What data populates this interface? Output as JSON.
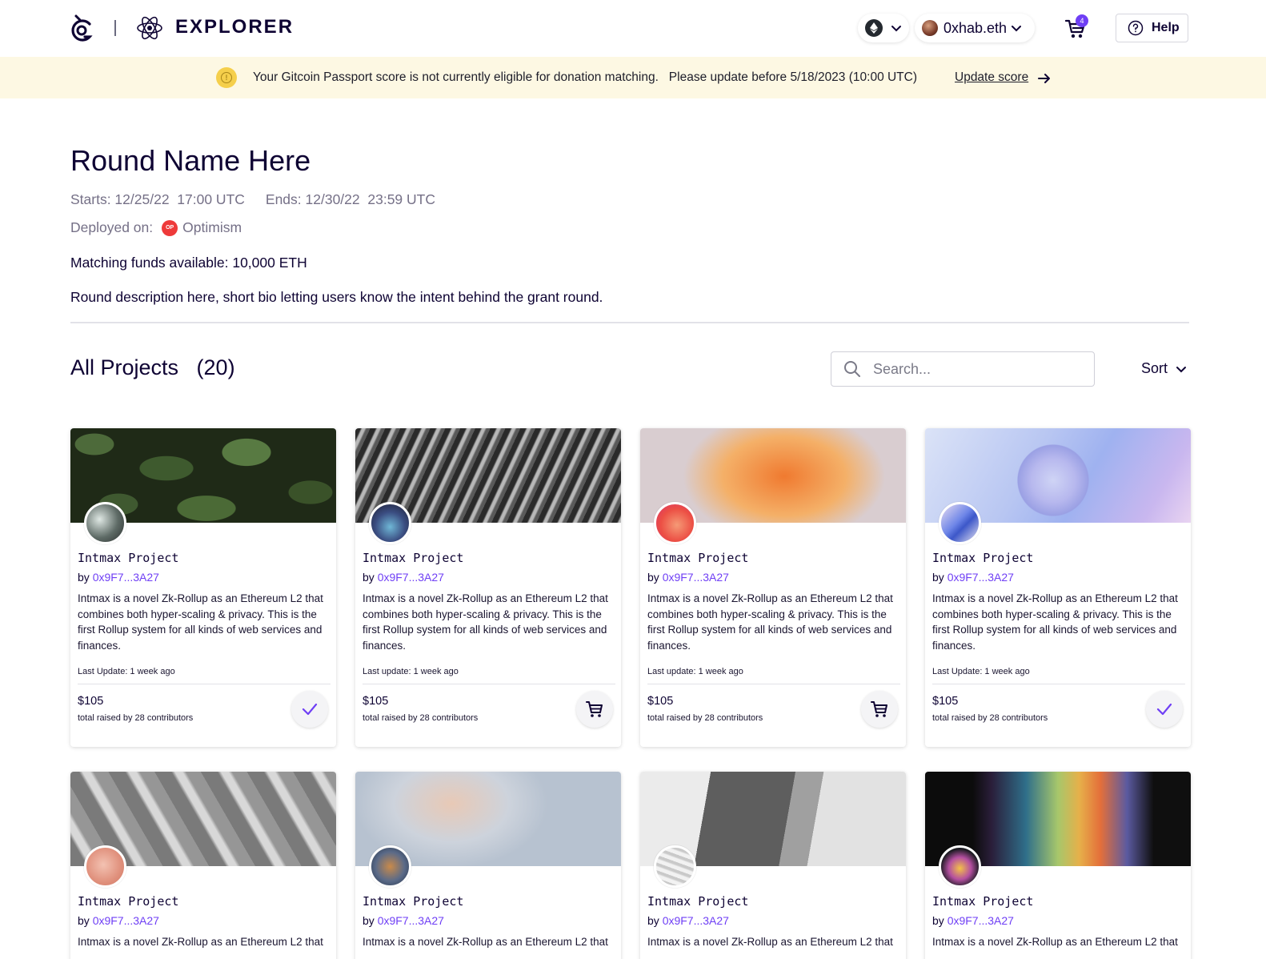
{
  "header": {
    "brand": "EXPLORER",
    "account_name": "0xhab.eth",
    "cart_count": "4",
    "help_label": "Help"
  },
  "banner": {
    "message": "Your Gitcoin Passport score is not currently eligible for donation matching.   Please update before 5/18/2023 (10:00 UTC)",
    "link_label": "Update score"
  },
  "round": {
    "title": "Round Name Here",
    "starts": "Starts: 12/25/22  17:00 UTC",
    "ends": "Ends: 12/30/22  23:59 UTC",
    "deployed_label": "Deployed on:",
    "network_badge": "OP",
    "network": "Optimism",
    "matching": "Matching funds available: 10,000 ETH",
    "description": "Round description here, short bio letting users know the intent behind the grant round."
  },
  "projects_header": {
    "title": "All Projects   (20)",
    "search_placeholder": "Search...",
    "sort_label": "Sort"
  },
  "projects": [
    {
      "title": "Intmax Project",
      "by": "by ",
      "address": "0x9F7...3A27",
      "description": "Intmax is a novel Zk-Rollup as an Ethereum L2 that combines both hyper-scaling & privacy. This is the first Rollup system for all kinds of web services and finances.",
      "last_update": "Last Update: 1 week ago",
      "amount": "$105",
      "contributors": "total raised by 28 contributors",
      "action_icon": "check-icon"
    },
    {
      "title": "Intmax Project",
      "by": "by ",
      "address": "0x9F7...3A27",
      "description": "Intmax is a novel Zk-Rollup as an Ethereum L2 that combines both hyper-scaling & privacy. This is the first Rollup system for all kinds of web services and finances.",
      "last_update": "Last update: 1 week ago",
      "amount": "$105",
      "contributors": "total raised by 28 contributors",
      "action_icon": "cart-icon"
    },
    {
      "title": "Intmax Project",
      "by": "by ",
      "address": "0x9F7...3A27",
      "description": "Intmax is a novel Zk-Rollup as an Ethereum L2 that combines both hyper-scaling & privacy. This is the first Rollup system for all kinds of web services and finances.",
      "last_update": "Last update: 1 week ago",
      "amount": "$105",
      "contributors": "total raised by 28 contributors",
      "action_icon": "cart-icon"
    },
    {
      "title": "Intmax Project",
      "by": "by ",
      "address": "0x9F7...3A27",
      "description": "Intmax is a novel Zk-Rollup as an Ethereum L2 that combines both hyper-scaling & privacy. This is the first Rollup system for all kinds of web services and finances.",
      "last_update": "Last Update: 1 week ago",
      "amount": "$105",
      "contributors": "total raised by 28 contributors",
      "action_icon": "check-icon"
    },
    {
      "title": "Intmax Project",
      "by": "by ",
      "address": "0x9F7...3A27",
      "description": "Intmax is a novel Zk-Rollup as an Ethereum L2 that"
    },
    {
      "title": "Intmax Project",
      "by": "by ",
      "address": "0x9F7...3A27",
      "description": "Intmax is a novel Zk-Rollup as an Ethereum L2 that"
    },
    {
      "title": "Intmax Project",
      "by": "by ",
      "address": "0x9F7...3A27",
      "description": "Intmax is a novel Zk-Rollup as an Ethereum L2 that"
    },
    {
      "title": "Intmax Project",
      "by": "by ",
      "address": "0x9F7...3A27",
      "description": "Intmax is a novel Zk-Rollup as an Ethereum L2 that"
    }
  ],
  "colors": {
    "accent": "#6f3ff5",
    "text": "#0e0333",
    "banner_bg": "#fdf8e3",
    "warning": "#f5cf4b",
    "optimism": "#ee3a3a"
  }
}
